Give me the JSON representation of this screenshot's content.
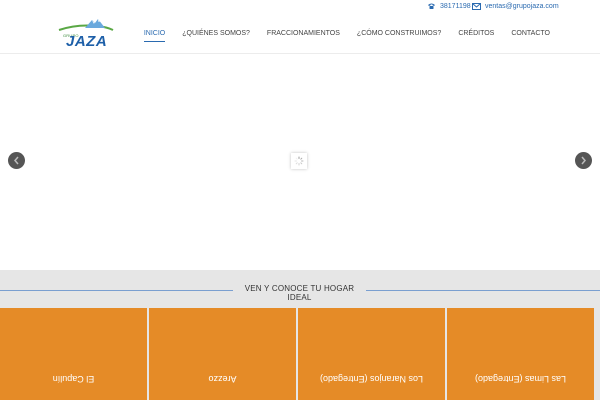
{
  "topbar": {
    "phone_icon": "phone-icon",
    "phone": "38171198",
    "email_icon": "envelope-icon",
    "email": "ventas@grupojaza.com"
  },
  "header": {
    "logo_small": "GRUPO",
    "logo_big": "JAZA",
    "nav": [
      {
        "label": "INICIO",
        "active": true
      },
      {
        "label": "¿QUIÉNES SOMOS?",
        "active": false
      },
      {
        "label": "FRACCIONAMIENTOS",
        "active": false
      },
      {
        "label": "¿CÓMO CONSTRUIMOS?",
        "active": false
      },
      {
        "label": "CRÉDITOS",
        "active": false
      },
      {
        "label": "CONTACTO",
        "active": false
      }
    ]
  },
  "slider": {
    "prev_icon": "chevron-left-icon",
    "next_icon": "chevron-right-icon",
    "loader_icon": "loading-spinner-icon"
  },
  "section": {
    "title": "VEN Y CONOCE TU HOGAR IDEAL",
    "cards": [
      {
        "label": "El Capulín"
      },
      {
        "label": "Arezzo"
      },
      {
        "label": "Los Naranjos (Entregado)"
      },
      {
        "label": "Las Limas (Entregado)"
      }
    ]
  },
  "colors": {
    "accent": "#2a6ab0",
    "card": "#e58b27",
    "lower_bg": "#e6e6e6"
  }
}
